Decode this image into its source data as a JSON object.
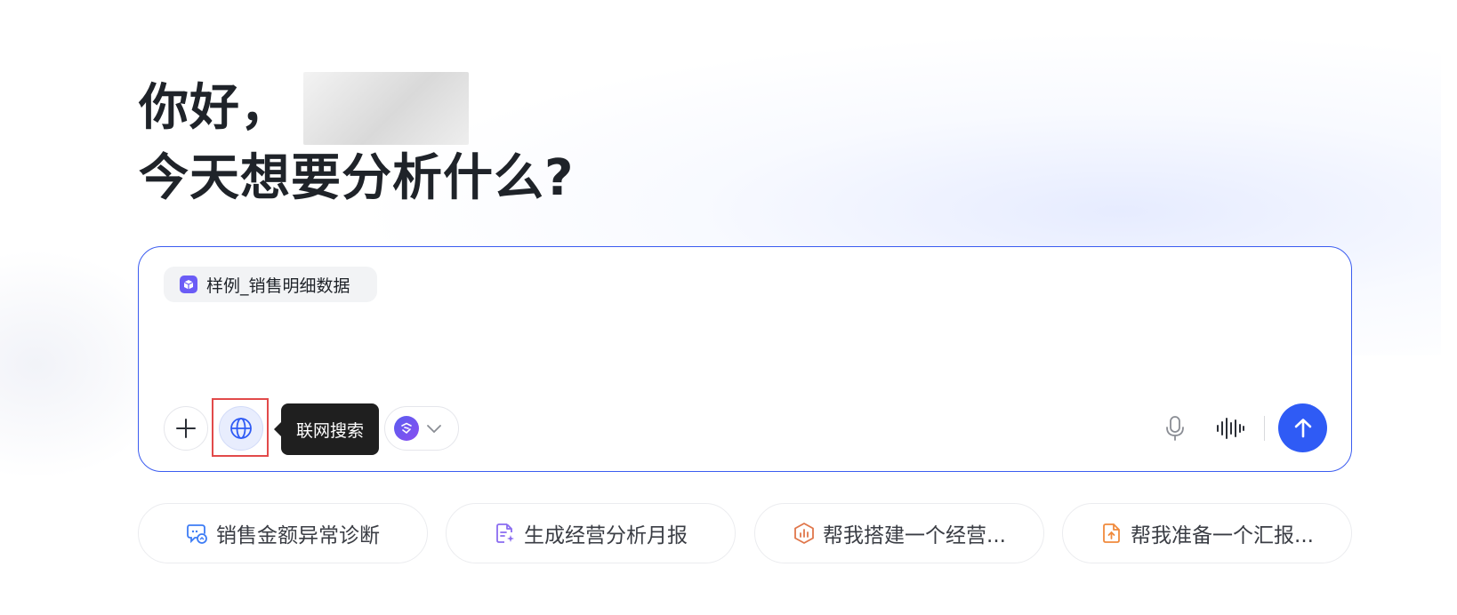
{
  "greeting": {
    "line1": "你好，",
    "line2": "今天想要分析什么?"
  },
  "input": {
    "dataset_chip_label": "样例_销售明细数据",
    "tooltip_label": "联网搜索"
  },
  "icons": {
    "plus": "plus-icon",
    "globe": "globe-icon",
    "model": "model-logo-icon",
    "chevron": "chevron-down-icon",
    "mic": "microphone-icon",
    "voice": "voice-wave-icon",
    "send": "arrow-up-icon"
  },
  "suggestions": [
    {
      "label": "销售金额异常诊断",
      "icon": "chat-chart-icon"
    },
    {
      "label": "生成经营分析月报",
      "icon": "document-sparkle-icon"
    },
    {
      "label": "帮我搭建一个经营...",
      "icon": "cube-chart-icon"
    },
    {
      "label": "帮我准备一个汇报...",
      "icon": "file-upload-icon"
    }
  ],
  "colors": {
    "accent": "#2f5bf5",
    "border": "#3b5cf0",
    "highlight": "#e24a4a",
    "model_logo": "#6b5cf6"
  }
}
